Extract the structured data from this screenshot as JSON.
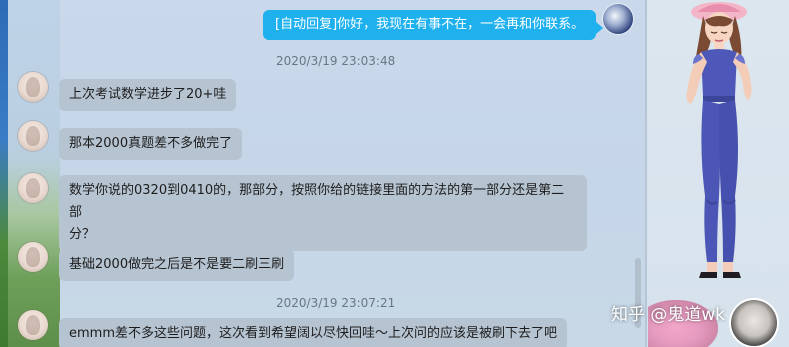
{
  "messages": [
    {
      "side": "out",
      "text": "[自动回复]你好，我现在有事不在，一会再和你联系。"
    },
    {
      "type": "timestamp",
      "text": "2020/3/19 23:03:48"
    },
    {
      "side": "in",
      "text": "上次考试数学进步了20+哇"
    },
    {
      "side": "in",
      "text": "那本2000真题差不多做完了"
    },
    {
      "side": "in",
      "text_line1": "数学你说的0320到0410的，那部分，按照你给的链接里面的方法的第一部分还是第二部",
      "text_line2": "分？"
    },
    {
      "side": "in",
      "text": "基础2000做完之后是不是要二刷三刷"
    },
    {
      "type": "timestamp",
      "text": "2020/3/19 23:07:21"
    },
    {
      "side": "in",
      "text": "emmm差不多这些问题，这次看到希望阔以尽快回哇～上次问的应该是被刷下去了吧"
    }
  ],
  "watermark": {
    "text": "知乎 @鬼道wk"
  },
  "colors": {
    "out_bubble": "#1fb1ee",
    "in_bubble": "#b6c3d1",
    "timestamp": "#6a7685"
  }
}
